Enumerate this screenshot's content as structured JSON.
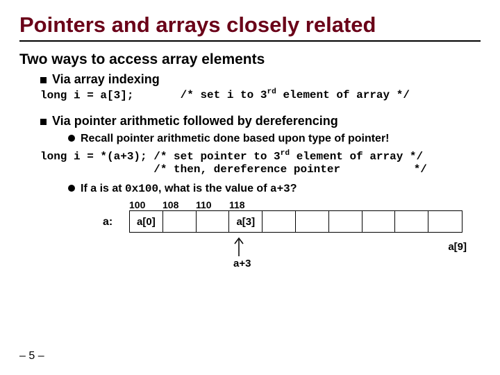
{
  "title": "Pointers and arrays closely related",
  "subtitle": "Two ways to access array elements",
  "bullet_indexing": "Via array indexing",
  "code_indexing_lhs": "long i = a[3];",
  "code_indexing_comment": "/* set i to 3",
  "code_indexing_comment_sup": "rd",
  "code_indexing_comment_tail": " element of array */",
  "bullet_pointer": "Via pointer arithmetic followed by dereferencing",
  "bullet_recall": "Recall pointer arithmetic done based upon type of pointer!",
  "code_pointer_l1a": "long i = *(a+3); /* set pointer to 3",
  "code_pointer_l1_sup": "rd",
  "code_pointer_l1b": " element of array */",
  "code_pointer_l2": "                 /* then, dereference pointer           */",
  "q_prefix": "If a is at ",
  "q_code1": "0x100",
  "q_mid": ", what is the value of ",
  "q_code2": "a+3",
  "q_suffix": "?",
  "addrs": [
    "100",
    "108",
    "110",
    "118"
  ],
  "a_label": "a:",
  "cell0": "a[0]",
  "cell3": "a[3]",
  "a3": "a+3",
  "a9": "a[9]",
  "page": "– 5 –"
}
